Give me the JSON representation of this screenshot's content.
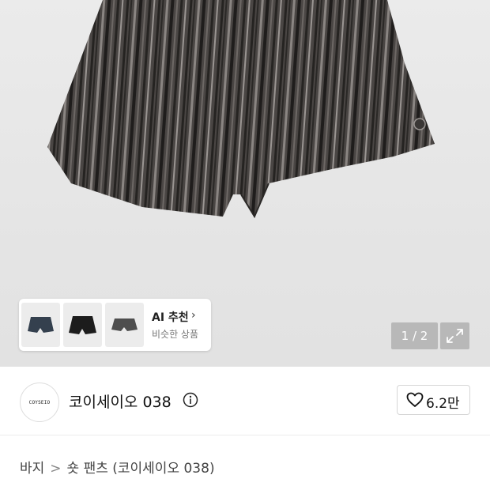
{
  "gallery": {
    "page_counter": "1 / 2",
    "ai_recommend": {
      "title": "AI 추천",
      "subtitle": "비슷한 상품",
      "chevron_icon": "chevron-right-icon",
      "thumbnails": [
        "thumbnail-navy-shorts",
        "thumbnail-black-shorts",
        "thumbnail-gray-shorts"
      ]
    },
    "expand_icon": "expand-icon"
  },
  "brand": {
    "logo_text": "COYSEIO",
    "name": "코이세이오 038",
    "info_icon": "info-icon",
    "like_count": "6.2만",
    "like_icon": "heart-icon"
  },
  "breadcrumb": {
    "items": [
      "바지",
      "숏 팬츠 (코이세이오 038)"
    ],
    "separator": ">"
  }
}
